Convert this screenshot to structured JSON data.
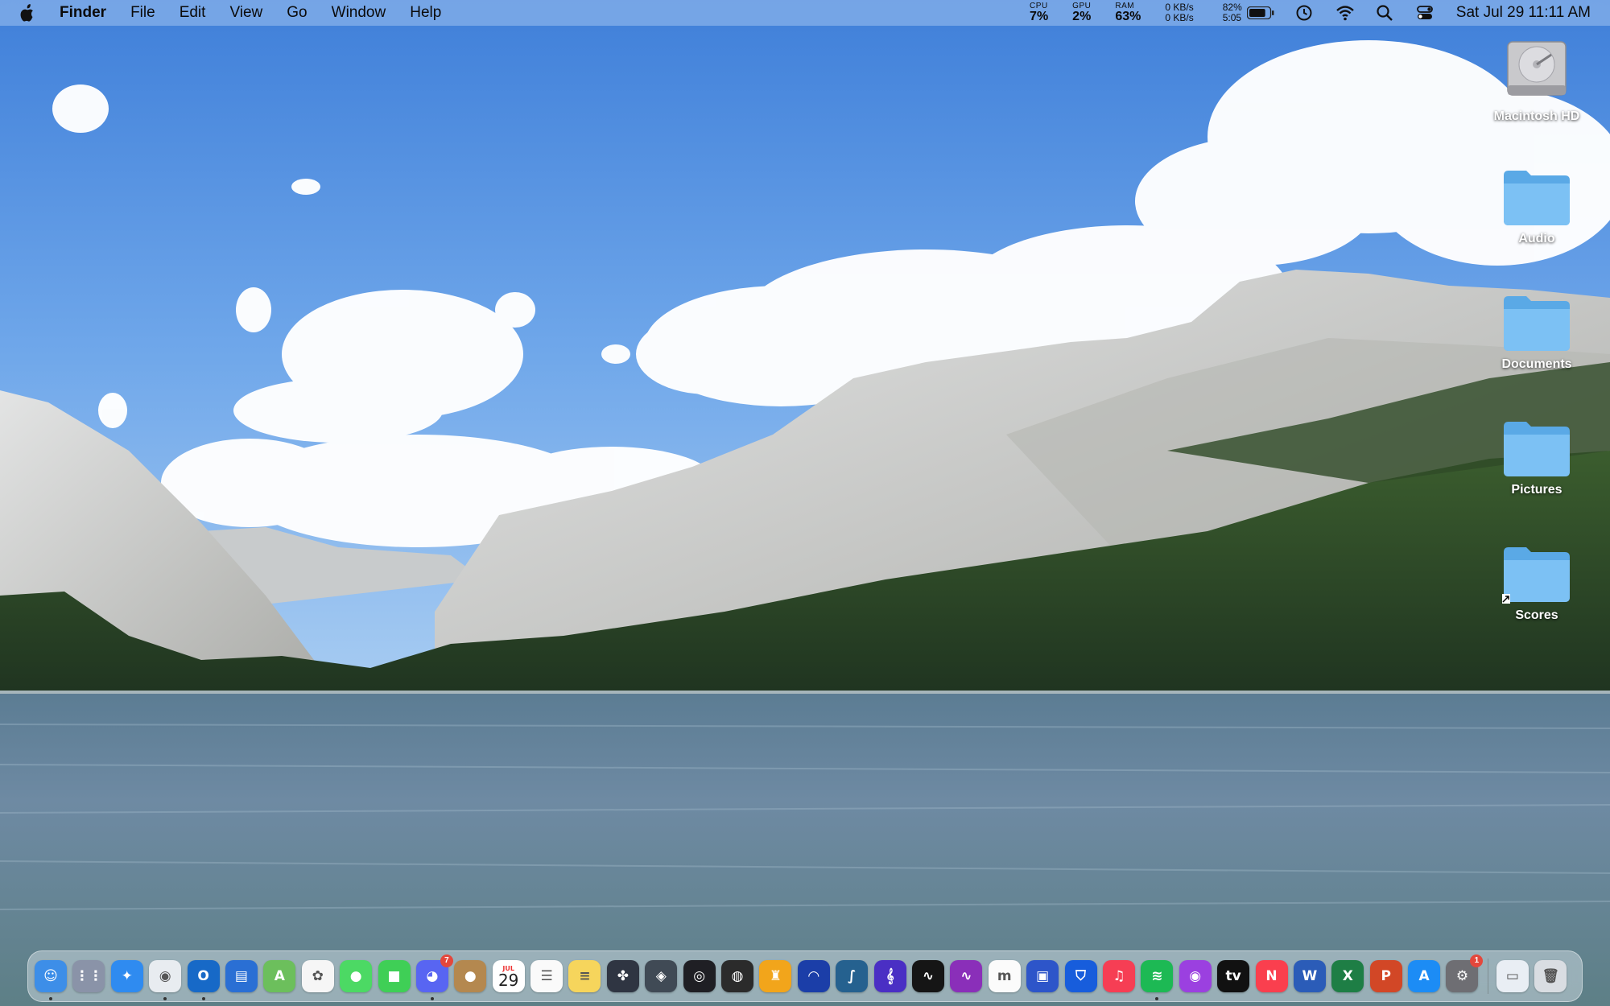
{
  "menubar": {
    "app_name": "Finder",
    "menus": [
      "File",
      "Edit",
      "View",
      "Go",
      "Window",
      "Help"
    ],
    "stats": {
      "cpu_label": "CPU",
      "cpu_value": "7%",
      "gpu_label": "GPU",
      "gpu_value": "2%",
      "ram_label": "RAM",
      "ram_value": "63%"
    },
    "network": {
      "up": "0 KB/s",
      "down": "0 KB/s"
    },
    "battery": {
      "percent": "82%",
      "time": "5:05",
      "level": 0.82
    },
    "clock": "Sat Jul 29  11:11 AM",
    "icons": [
      "apple-icon",
      "battery-icon",
      "time-machine-icon",
      "wifi-icon",
      "spotlight-icon",
      "control-center-icon"
    ]
  },
  "desktop": {
    "items": [
      {
        "label": "Macintosh HD",
        "icon": "hard-drive-icon"
      },
      {
        "label": "Audio",
        "icon": "folder-icon"
      },
      {
        "label": "Documents",
        "icon": "folder-icon"
      },
      {
        "label": "Pictures",
        "icon": "folder-icon"
      },
      {
        "label": "Scores",
        "icon": "folder-alias-icon"
      }
    ]
  },
  "dock": {
    "apps": [
      {
        "name": "finder-icon",
        "color": "#3d8ee8",
        "glyph": "☺",
        "running": true
      },
      {
        "name": "launchpad-icon",
        "color": "#8a93a8",
        "glyph": "⋮⋮"
      },
      {
        "name": "safari-icon",
        "color": "#2f8bf0",
        "glyph": "✦"
      },
      {
        "name": "chrome-icon",
        "color": "#e8ecf0",
        "glyph": "◉",
        "running": true
      },
      {
        "name": "outlook-icon",
        "color": "#1769c7",
        "glyph": "O",
        "running": true
      },
      {
        "name": "files-icon",
        "color": "#2a6fd4",
        "glyph": "▤"
      },
      {
        "name": "maps-icon",
        "color": "#6cbf5c",
        "glyph": "A"
      },
      {
        "name": "photos-icon",
        "color": "#f6f6f6",
        "glyph": "✿"
      },
      {
        "name": "messages-icon",
        "color": "#4cd964",
        "glyph": "●"
      },
      {
        "name": "facetime-icon",
        "color": "#3fcf56",
        "glyph": "■"
      },
      {
        "name": "discord-icon",
        "color": "#5865f2",
        "glyph": "◕",
        "badge": "7",
        "running": true
      },
      {
        "name": "contacts-icon",
        "color": "#b4884f",
        "glyph": "●"
      },
      {
        "name": "calendar-icon",
        "color": "#ffffff",
        "month": "JUL",
        "day": "29"
      },
      {
        "name": "reminders-icon",
        "color": "#fafafa",
        "glyph": "☰"
      },
      {
        "name": "notes-icon",
        "color": "#f6d55c",
        "glyph": "≡"
      },
      {
        "name": "davinci-resolve-icon",
        "color": "#2f3542",
        "glyph": "✤"
      },
      {
        "name": "compressor-icon",
        "color": "#404a55",
        "glyph": "◈"
      },
      {
        "name": "obs-icon",
        "color": "#1f1f24",
        "glyph": "◎"
      },
      {
        "name": "logic-pro-icon",
        "color": "#2b2b2b",
        "glyph": "◍"
      },
      {
        "name": "mainstage-icon",
        "color": "#f2a51b",
        "glyph": "♜"
      },
      {
        "name": "audacity-icon",
        "color": "#1b3ea8",
        "glyph": "◠"
      },
      {
        "name": "sonic-visualiser-icon",
        "color": "#25618f",
        "glyph": "∫"
      },
      {
        "name": "musescore-icon",
        "color": "#4a2fc4",
        "glyph": "𝄞"
      },
      {
        "name": "activity-monitor-icon",
        "color": "#151515",
        "glyph": "∿"
      },
      {
        "name": "waveform-icon",
        "color": "#8a2fb9",
        "glyph": "∿"
      },
      {
        "name": "miro-icon",
        "color": "#fbfbfb",
        "glyph": "m"
      },
      {
        "name": "screens-icon",
        "color": "#2d55c9",
        "glyph": "▣"
      },
      {
        "name": "bitwarden-icon",
        "color": "#175ddc",
        "glyph": "⛉"
      },
      {
        "name": "music-icon",
        "color": "#f63e54",
        "glyph": "♫"
      },
      {
        "name": "spotify-icon",
        "color": "#1db954",
        "glyph": "≋",
        "running": true
      },
      {
        "name": "podcasts-icon",
        "color": "#9b40e0",
        "glyph": "◉"
      },
      {
        "name": "apple-tv-icon",
        "color": "#111111",
        "glyph": "tv"
      },
      {
        "name": "news-icon",
        "color": "#fa3f4e",
        "glyph": "N"
      },
      {
        "name": "word-icon",
        "color": "#2b5cb8",
        "glyph": "W"
      },
      {
        "name": "excel-icon",
        "color": "#1e7e45",
        "glyph": "X"
      },
      {
        "name": "powerpoint-icon",
        "color": "#d24726",
        "glyph": "P"
      },
      {
        "name": "app-store-icon",
        "color": "#1c8cf5",
        "glyph": "A"
      },
      {
        "name": "system-settings-icon",
        "color": "#6e6e73",
        "glyph": "⚙",
        "badge": "1"
      }
    ],
    "right": [
      {
        "name": "downloads-stack-icon",
        "color": "#e9eef4",
        "glyph": "▭"
      },
      {
        "name": "trash-icon",
        "color": "#d9dde2",
        "glyph": "🗑"
      }
    ]
  }
}
